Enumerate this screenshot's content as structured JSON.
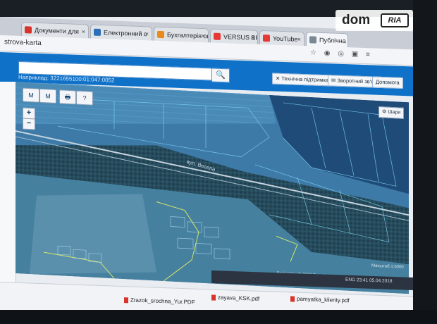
{
  "browser": {
    "tabs": [
      {
        "label": "Документи для",
        "icon_color": "#d8342c"
      },
      {
        "label": "Електронний с",
        "icon_color": "#2d6fb8"
      },
      {
        "label": "Бухгалтерія он",
        "icon_color": "#e98a1b"
      },
      {
        "label": "VERSUS BPM С",
        "icon_color": "#e53935"
      },
      {
        "label": "YouTube",
        "icon_color": "#e53935"
      },
      {
        "label": "Публічна кадас",
        "icon_color": "#7a8896"
      }
    ],
    "url": "strova-karta"
  },
  "site": {
    "search_value": "",
    "example_text": "Наприклад: 3221655100:01:047:0052",
    "buttons": {
      "support": "Технічна підтримка",
      "feedback": "Зворотний зв'язок",
      "help": "Допомога"
    }
  },
  "map": {
    "tools": [
      "М",
      "М",
      "🖶",
      "?"
    ],
    "zoom_in": "+",
    "zoom_out": "−",
    "layers_label": "Шари",
    "road_label": "вул. Весела",
    "copyright": "Дані карти © 2018 Google",
    "scale": "Масштаб 1:5000",
    "accent_color": "#0f72c8"
  },
  "taskbar": {
    "tray_text": "ENG  23:41  05.04.2018"
  },
  "downloads": [
    {
      "name": "Zrazok_srochna_Yur.PDF"
    },
    {
      "name": "zayava_KSK.pdf"
    },
    {
      "name": "pamyatka_klienty.pdf"
    }
  ],
  "watermark": {
    "dom": "dom",
    "ria": "RIA"
  }
}
